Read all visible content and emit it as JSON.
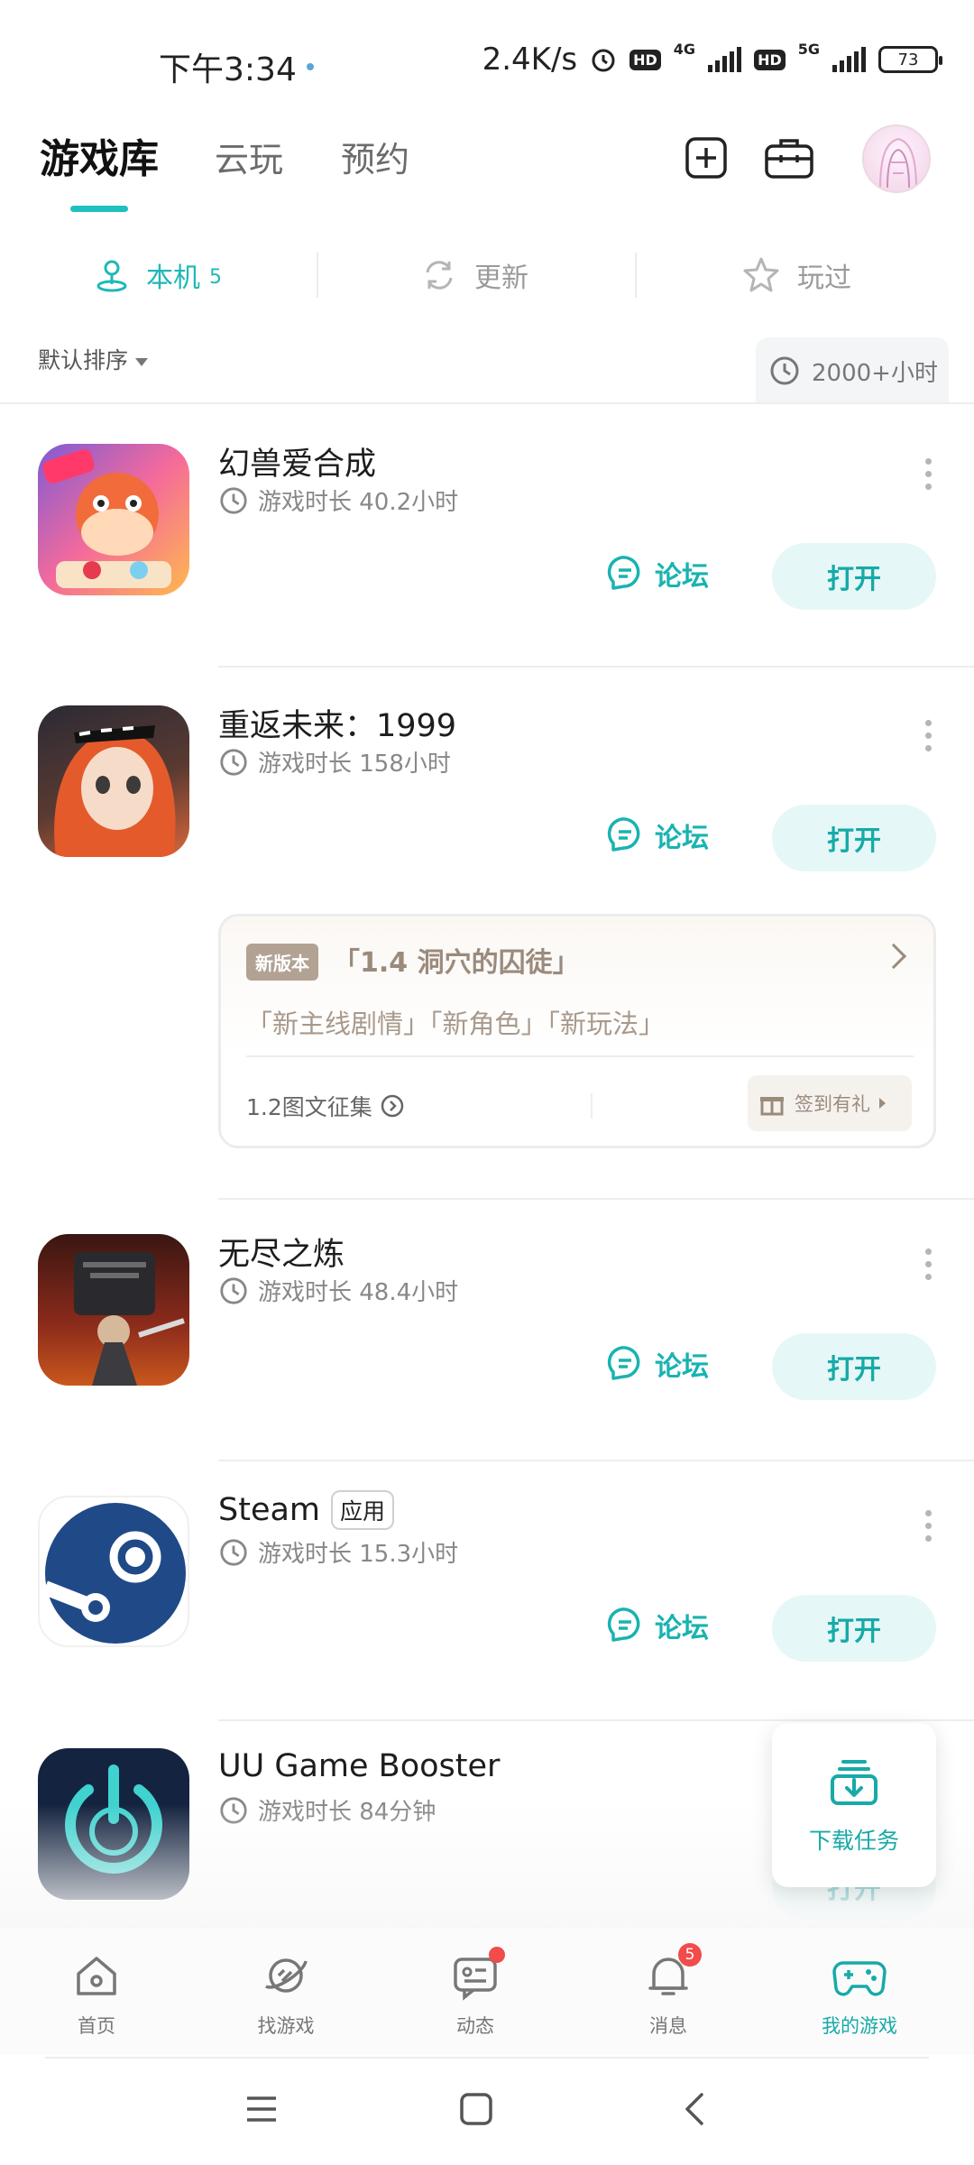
{
  "status_bar": {
    "time": "下午3:34",
    "net_speed": "2.4K/s",
    "hd1": "HD",
    "net1": "4G",
    "hd2": "HD",
    "net2": "5G",
    "battery": "73"
  },
  "top_tabs": [
    {
      "label": "游戏库",
      "active": true
    },
    {
      "label": "云玩",
      "active": false
    },
    {
      "label": "预约",
      "active": false
    }
  ],
  "sub_tabs": {
    "local": {
      "label": "本机",
      "count": "5"
    },
    "update": {
      "label": "更新"
    },
    "played": {
      "label": "玩过"
    }
  },
  "sort": {
    "label": "默认排序",
    "hours": "2000+小时"
  },
  "games": [
    {
      "name": "幻兽爱合成",
      "playtime": "游戏时长 40.2小时",
      "forum": "论坛",
      "open": "打开"
    },
    {
      "name": "重返未来：1999",
      "playtime": "游戏时长 158小时",
      "forum": "论坛",
      "open": "打开"
    },
    {
      "name": "无尽之炼",
      "playtime": "游戏时长 48.4小时",
      "forum": "论坛",
      "open": "打开"
    },
    {
      "name": "Steam",
      "tag": "应用",
      "playtime": "游戏时长 15.3小时",
      "forum": "论坛",
      "open": "打开"
    },
    {
      "name": "UU Game Booster",
      "playtime": "游戏时长 84分钟",
      "open": "打开"
    }
  ],
  "update_card": {
    "tag": "新版本",
    "title": "「1.4 洞穴的囚徒」",
    "subtitle": "「新主线剧情」「新角色」「新玩法」",
    "left_link": "1.2图文征集",
    "gift": "签到有礼"
  },
  "download": {
    "label": "下载任务"
  },
  "bottom_nav": [
    {
      "label": "首页"
    },
    {
      "label": "找游戏"
    },
    {
      "label": "动态"
    },
    {
      "label": "消息",
      "badge": "5"
    },
    {
      "label": "我的游戏",
      "active": true
    }
  ],
  "colors": {
    "accent": "#1fc0bf",
    "accent_text": "#17aaa8",
    "open_bg": "#e6f7f7",
    "update_brown": "#9b8b7d",
    "badge_red": "#f24b4b"
  }
}
